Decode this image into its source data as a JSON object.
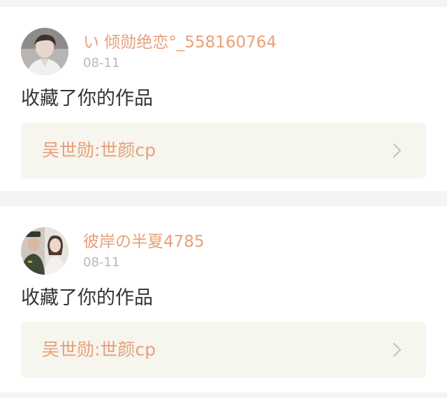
{
  "notifications": [
    {
      "username": "い 倾勋绝恋°_558160764",
      "date": "08-11",
      "action": "收藏了你的作品",
      "work_title": "吴世勋:世颜cp",
      "avatar_icon": "user-avatar-icon"
    },
    {
      "username": "彼岸の半夏4785",
      "date": "08-11",
      "action": "收藏了你的作品",
      "work_title": "吴世勋:世颜cp",
      "avatar_icon": "user-avatar-icon"
    }
  ],
  "colors": {
    "accent": "#e8a07a",
    "date": "#b9b9b9",
    "text": "#333333",
    "work_bg": "#f6f5ee",
    "page_bg": "#f4f4f4"
  }
}
